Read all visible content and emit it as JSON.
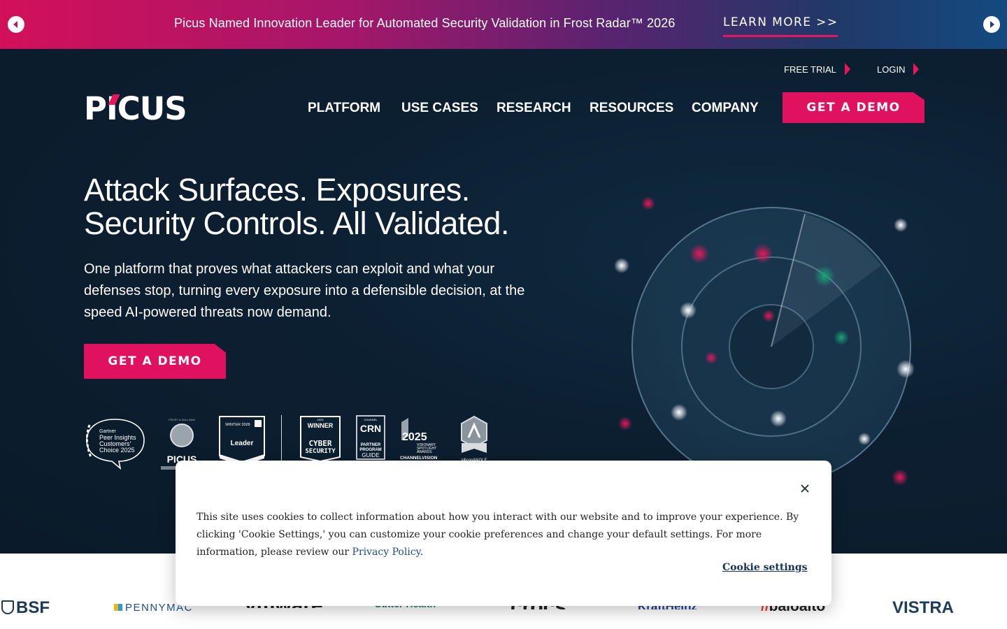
{
  "announcement": {
    "text": "Picus Named Innovation Leader for Automated Security Validation in Frost Radar™ 2026",
    "link": "LEARN MORE >>"
  },
  "header": {
    "logo": "PICUS",
    "utility": {
      "free_trial": "FREE TRIAL",
      "login": "LOGIN"
    },
    "nav": [
      "PLATFORM",
      "USE CASES",
      "RESEARCH",
      "RESOURCES",
      "COMPANY"
    ],
    "cta": "GET A DEMO"
  },
  "hero": {
    "headline_line1": "Attack Surfaces. Exposures.",
    "headline_line2": "Security Controls. All Validated.",
    "subtext": "One platform that proves what attackers can exploit and what your defenses stop, turning every exposure into a defensible decision, at the speed AI-powered threats now demand.",
    "cta": "GET A DEMO"
  },
  "badges": {
    "gartner": {
      "line1": "Gartner",
      "line2": "Peer Insights",
      "line3": "Customers'",
      "line4": "Choice 2025"
    },
    "frost": {
      "top": "FROST & SULLIVAN",
      "name": "PICUS"
    },
    "g2": {
      "top": "WINTER 2026",
      "label": "Leader"
    },
    "cyber": {
      "year": "2025",
      "label1": "WINNER",
      "label2": "CYBER",
      "label3": "SECURITY"
    },
    "crn": {
      "top": "CHANNEL",
      "name": "CRN",
      "line1": "PARTNER",
      "line2": "PROGRAM",
      "line3": "GUIDE"
    },
    "channelvision": {
      "year": "2025",
      "line1": "VISIONARY",
      "line2": "SPOTLIGHT",
      "line3": "AWARDS",
      "line4": "CHANNELVISION"
    },
    "silicon": {
      "text": "siliconANGLE"
    }
  },
  "clients": [
    "BSF",
    "PENNYMAC",
    "vmware",
    "Sutter Health",
    "crocs",
    "KraftHeinz",
    "paloalto",
    "VISTRA"
  ],
  "cookie": {
    "text_before": "This site uses cookies to collect information about how you interact with our website and to improve your experience. By clicking 'Cookie Settings,' you can customize your cookie preferences and change your default settings. For more information, please review our ",
    "link": "Privacy Policy",
    "text_after": ".",
    "settings": "Cookie settings"
  },
  "colors": {
    "brand_pink": "#e0115e",
    "hero_bg": "#0b1c2c"
  }
}
